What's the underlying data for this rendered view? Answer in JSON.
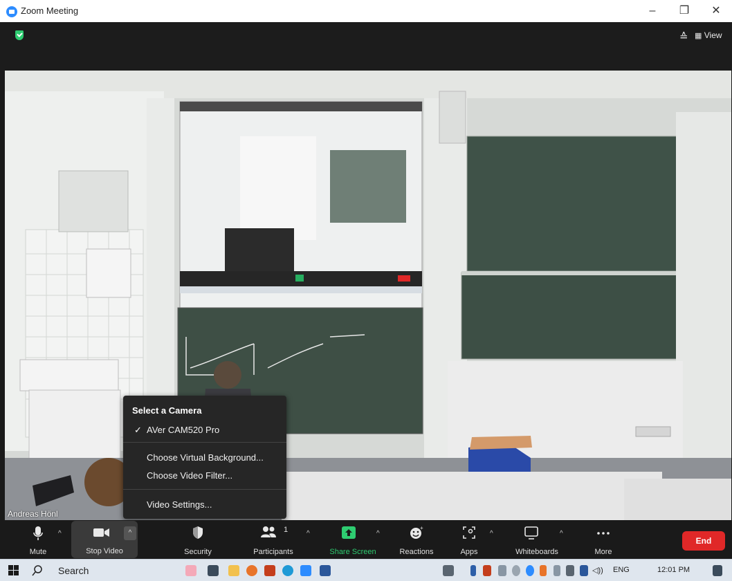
{
  "window": {
    "title": "Zoom Meeting",
    "min": "–",
    "max": "❐",
    "close": "✕"
  },
  "topbar": {
    "view_label": "View"
  },
  "video": {
    "participant_name": "Andreas Hönl"
  },
  "camera_menu": {
    "heading": "Select a Camera",
    "check": "✓",
    "selected_camera": "AVer CAM520 Pro",
    "items": [
      "Choose Virtual Background...",
      "Choose Video Filter...",
      "Video Settings..."
    ]
  },
  "toolbar": {
    "mute": "Mute",
    "stop_video": "Stop Video",
    "security": "Security",
    "participants": "Participants",
    "participants_count": "1",
    "share_screen": "Share Screen",
    "reactions": "Reactions",
    "apps": "Apps",
    "whiteboards": "Whiteboards",
    "more": "More",
    "end": "End",
    "share_color": "#2ecc71",
    "end_color": "#e02828"
  },
  "taskbar": {
    "search": "Search",
    "lang": "ENG",
    "time": "12:01 PM"
  }
}
